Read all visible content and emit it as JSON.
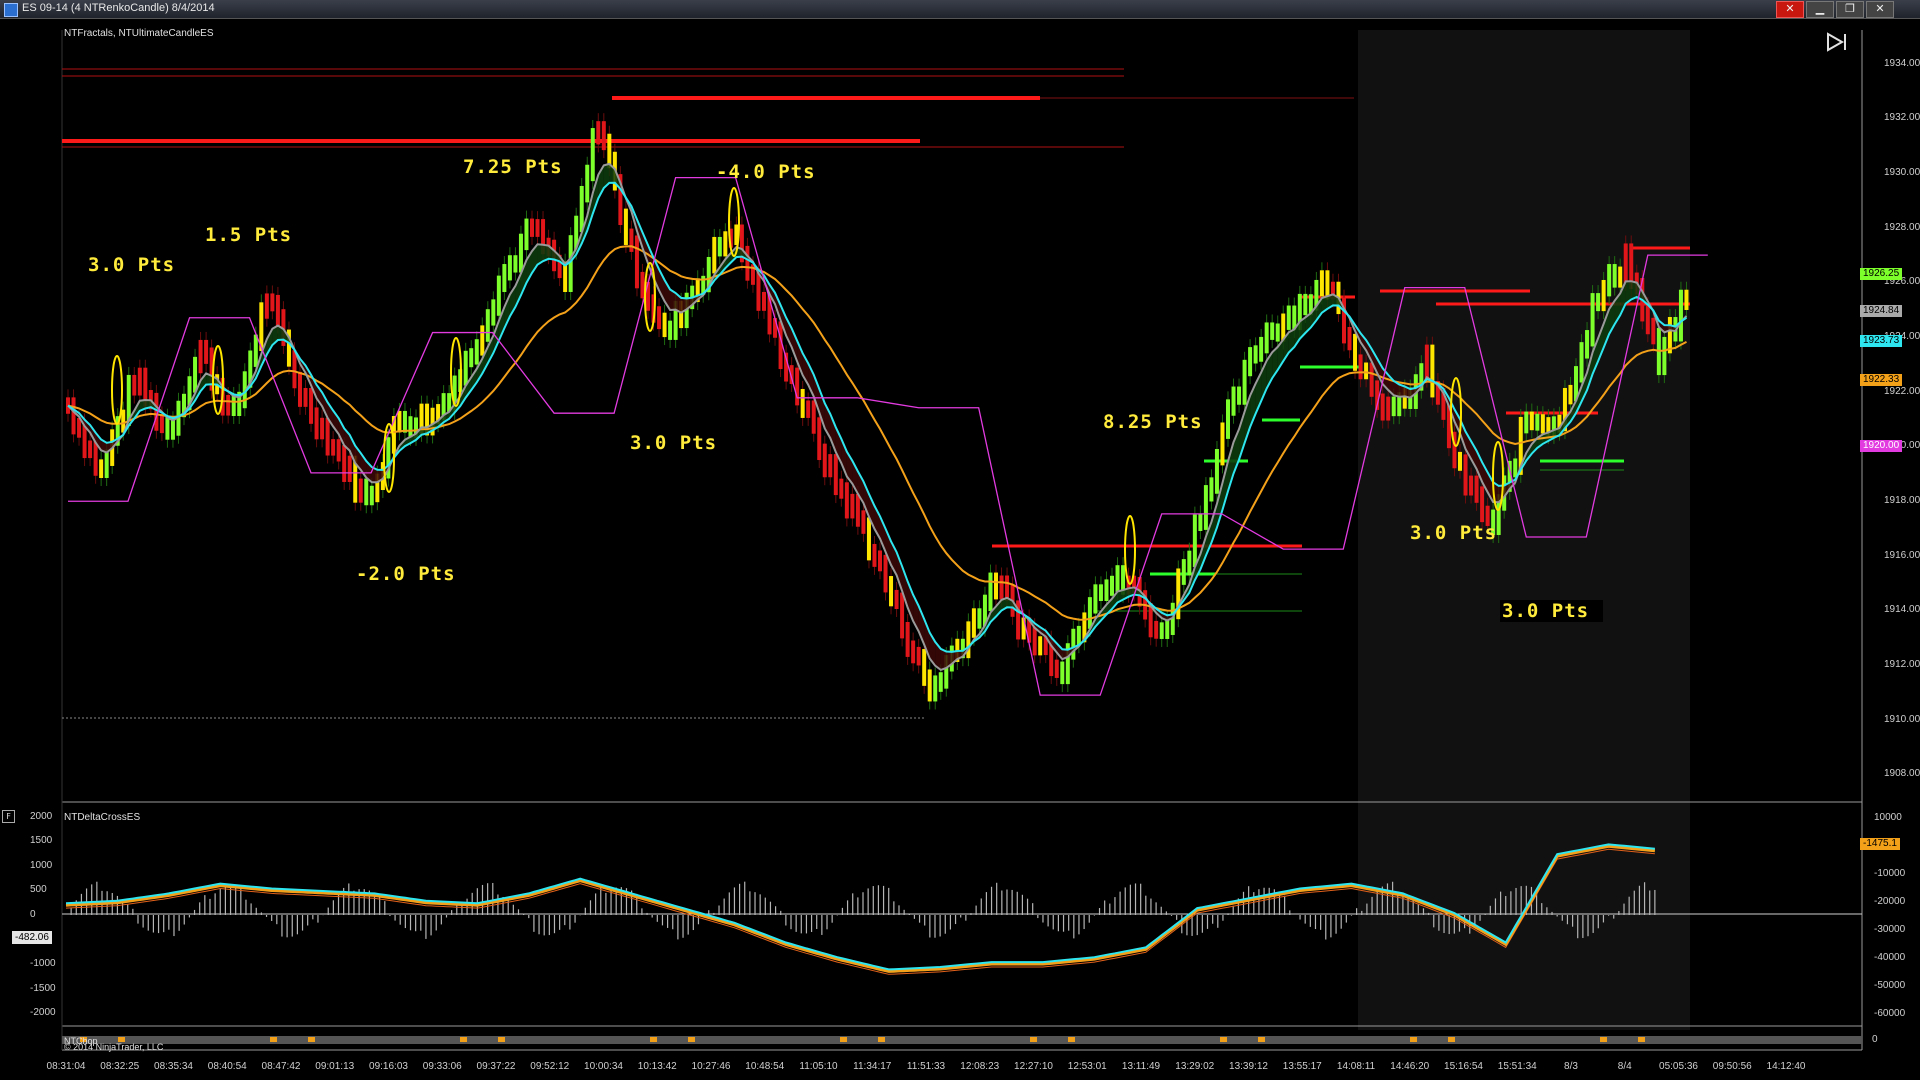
{
  "window": {
    "title": "ES 09-14 (4 NTRenkoCandle)  8/4/2014",
    "buttons": {
      "close": "✕",
      "restore": "❐",
      "minimize": "▁"
    }
  },
  "price_panel": {
    "indicators_label": "NTFractals, NTUltimateCandleES",
    "price_ticks": [
      "1934.00",
      "1932.00",
      "1930.00",
      "1928.00",
      "1926.00",
      "1924.00",
      "1922.00",
      "1920.00",
      "1918.00",
      "1916.00",
      "1914.00",
      "1912.00",
      "1910.00",
      "1908.00"
    ],
    "price_tags": [
      {
        "text": "1926.25",
        "color": "#7cff2a"
      },
      {
        "text": "1924.84",
        "color": "#aaaaaa"
      },
      {
        "text": "1923.73",
        "color": "#2ee6f0"
      },
      {
        "text": "1922.33",
        "color": "#f4a11a"
      },
      {
        "text": "1920.00",
        "color": "#e23be0"
      }
    ],
    "annotations": [
      {
        "text": "3.0  Pts"
      },
      {
        "text": "1.5  Pts"
      },
      {
        "text": "7.25  Pts"
      },
      {
        "text": "-4.0  Pts"
      },
      {
        "text": "-2.0  Pts"
      },
      {
        "text": "3.0  Pts"
      },
      {
        "text": "8.25  Pts"
      },
      {
        "text": "3.0  Pts"
      },
      {
        "text": "3.0  Pts"
      }
    ]
  },
  "indicator_panel": {
    "label": "NTDeltaCrossES",
    "f_button": "F",
    "left_ticks": [
      "2000",
      "1500",
      "1000",
      "500",
      "0",
      "-500",
      "-1000",
      "-1500",
      "-2000"
    ],
    "right_ticks": [
      "10000",
      "0",
      "-10000",
      "-20000",
      "-30000",
      "-40000",
      "-50000",
      "-60000"
    ],
    "left_tag": "-482.06",
    "right_tag": "-1475.1"
  },
  "bottom_strip": {
    "label": "NTChop",
    "copyright": "© 2014 NinjaTrader, LLC",
    "right_tick": "0"
  },
  "time_axis": [
    "08:31:04",
    "08:32:25",
    "08:35:34",
    "08:40:54",
    "08:47:42",
    "09:01:13",
    "09:16:03",
    "09:33:06",
    "09:37:22",
    "09:52:12",
    "10:00:34",
    "10:13:42",
    "10:27:46",
    "10:48:54",
    "11:05:10",
    "11:34:17",
    "11:51:33",
    "12:08:23",
    "12:27:10",
    "12:53:01",
    "13:11:49",
    "13:29:02",
    "13:39:12",
    "13:55:17",
    "14:08:11",
    "14:46:20",
    "15:16:54",
    "15:51:34",
    "8/3",
    "8/4",
    "05:05:36",
    "09:50:56",
    "14:12:40"
  ],
  "colors": {
    "up_bar": "#7cff2a",
    "down_bar": "#e0161a",
    "neutral_bar": "#ffe600",
    "fast_ma": "#2ee6f0",
    "slow_ma": "#f4a11a",
    "mid_ma": "#9a9a9a",
    "fractal": "#e23be0"
  },
  "chart_data": {
    "type": "line",
    "price_series": [
      1921.5,
      1919,
      1922.5,
      1920.5,
      1923.5,
      1921,
      1925.5,
      1922,
      1920,
      1918,
      1921,
      1921,
      1923,
      1926,
      1928,
      1926,
      1932,
      1927,
      1924,
      1926,
      1928,
      1925,
      1922,
      1919,
      1917,
      1914,
      1911,
      1913,
      1915,
      1913,
      1912,
      1915,
      1915,
      1913,
      1917,
      1921,
      1924,
      1925,
      1926,
      1923,
      1921,
      1923,
      1919,
      1917,
      1921,
      1921,
      1925,
      1927,
      1923,
      1926
    ],
    "ylim": [
      1907.5,
      1934.5
    ],
    "delta_series": [
      200,
      250,
      400,
      600,
      500,
      450,
      400,
      250,
      200,
      400,
      700,
      400,
      100,
      -200,
      -600,
      -900,
      -1150,
      -1100,
      -1000,
      -1000,
      -900,
      -700,
      100,
      300,
      500,
      600,
      400,
      0,
      -600,
      1200,
      1400,
      1300
    ],
    "delta_ylim": [
      -2100,
      2100
    ]
  }
}
